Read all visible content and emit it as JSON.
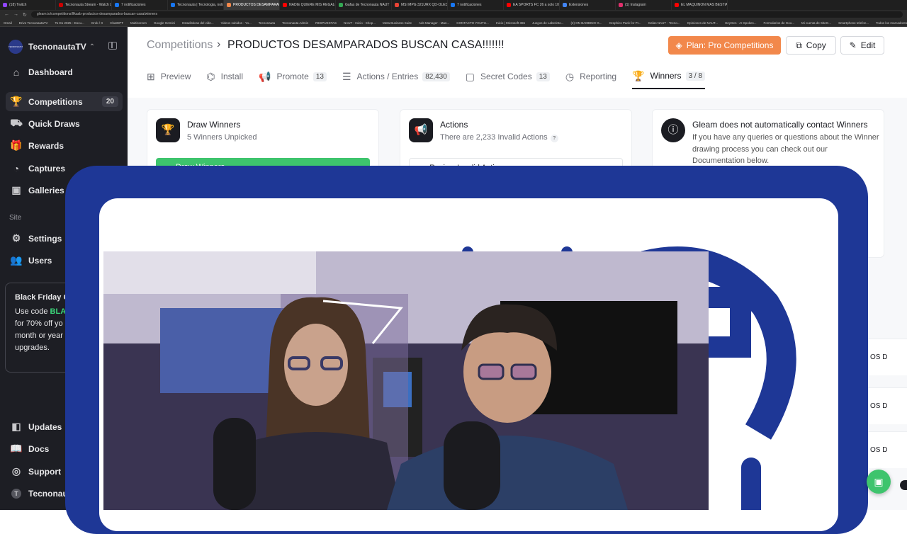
{
  "browser": {
    "tabs": [
      {
        "label": "(18) Twitch",
        "color": "#9146ff",
        "active": false
      },
      {
        "label": "Tecnonauta Stream - Watch Li",
        "color": "#cc0000",
        "active": false
      },
      {
        "label": "7 notificaciones",
        "color": "#1877f2",
        "active": false
      },
      {
        "label": "Tecnonauta | Tecnologia, noticia",
        "color": "#1877f2",
        "active": false
      },
      {
        "label": "PRODUCTOS DESAMPARADO",
        "color": "#f2884b",
        "active": true
      },
      {
        "label": "NADIE QUIERE MIS REGALOS!",
        "color": "#ff0000",
        "active": false
      },
      {
        "label": "Gafas de Tecnonauta NAUT",
        "color": "#34a853",
        "active": false
      },
      {
        "label": "MSI MPG 321URX QD-OLED M",
        "color": "#ea4335",
        "active": false
      },
      {
        "label": "7 notificaciones",
        "color": "#1877f2",
        "active": false
      },
      {
        "label": "EA SPORTS FC 26 a solo 10,50",
        "color": "#ff0000",
        "active": false
      },
      {
        "label": "Extensiones",
        "color": "#4285f4",
        "active": false
      },
      {
        "label": "(1) Instagram",
        "color": "#e1306c",
        "active": false
      },
      {
        "label": "EL MAQUINON MAS BESTIAL",
        "color": "#ff0000",
        "active": false
      }
    ],
    "url": "gleam.io/competitions/Ifkasb-productos-desamparados-buscan-casa/winners",
    "bookmarks": [
      "Gmail",
      "Drive TecnonautaTV",
      "To Do 2025 - Docu...",
      "Grok / X",
      "ChatGPT",
      "Multiscreen",
      "Google Gemini",
      "Estadisticas del vide...",
      "Videos subidos - Yo...",
      "Tecnonauta",
      "Tecnonauta Admin",
      "RESPUESTAS",
      "NAUT - Inicio - Shop...",
      "Meta Business Suite",
      "Ads Manager - Man...",
      "CONTACTO YOUTU...",
      "Inicio | Microsoft 365",
      "Juegos de Laberinto...",
      "(2) ON BAMBINO G...",
      "Graphics Pack for Pr...",
      "Gafas NAUT - Tecno...",
      "Opiniones de NAUT...",
      "HeyGen - AI Spokes...",
      "Formularios de Goo...",
      "Mi cuenta de SiteG...",
      "Smartphone telefon...",
      "Todos los marcadores"
    ]
  },
  "sidebar": {
    "brand": "TecnonautaTV",
    "brand_logo": "TECNONAUTA",
    "items": [
      {
        "label": "Dashboard",
        "icon": "home-icon",
        "glyph": "⌂"
      },
      {
        "label": "Competitions",
        "icon": "trophy-icon",
        "glyph": "🏆",
        "count": "20"
      },
      {
        "label": "Quick Draws",
        "icon": "quick-draw-icon",
        "glyph": "⛟"
      },
      {
        "label": "Rewards",
        "icon": "gift-icon",
        "glyph": "🎁"
      },
      {
        "label": "Captures",
        "icon": "capture-icon",
        "glyph": "◔"
      },
      {
        "label": "Galleries",
        "icon": "image-icon",
        "glyph": "▣"
      }
    ],
    "site_label": "Site",
    "site_items": [
      {
        "label": "Settings",
        "icon": "gear-icon",
        "glyph": "⚙"
      },
      {
        "label": "Users",
        "icon": "users-icon",
        "glyph": "👥"
      }
    ],
    "promo": {
      "title": "Black Friday C",
      "line1_pre": "Use code ",
      "line1_code": "BLA",
      "line2": "for 70% off yo",
      "line3": "month or year",
      "line4": "upgrades."
    },
    "bottom_items": [
      {
        "label": "Updates",
        "icon": "updates-icon",
        "glyph": "◧"
      },
      {
        "label": "Docs",
        "icon": "book-icon",
        "glyph": "📖"
      },
      {
        "label": "Support",
        "icon": "support-icon",
        "glyph": "◎"
      },
      {
        "label": "Tecnonaut",
        "icon": "avatar",
        "glyph": "T"
      }
    ]
  },
  "header": {
    "breadcrumb_link": "Competitions",
    "breadcrumb_sep": "›",
    "title": "PRODUCTOS DESAMPARADOS BUSCAN CASA!!!!!!!",
    "plan_button": "Plan: Pro Competitions",
    "copy_button": "Copy",
    "edit_button": "Edit"
  },
  "tabs": [
    {
      "label": "Preview",
      "icon": "grid-icon",
      "glyph": "⊞"
    },
    {
      "label": "Install",
      "icon": "install-icon",
      "glyph": "⌬"
    },
    {
      "label": "Promote",
      "icon": "megaphone-icon",
      "glyph": "📢",
      "count": "13"
    },
    {
      "label": "Actions / Entries",
      "icon": "list-icon",
      "glyph": "☰",
      "count": "82,430"
    },
    {
      "label": "Secret Codes",
      "icon": "code-icon",
      "glyph": "▢",
      "count": "13"
    },
    {
      "label": "Reporting",
      "icon": "chart-icon",
      "glyph": "◷"
    },
    {
      "label": "Winners",
      "icon": "trophy-icon",
      "glyph": "🏆",
      "count": "3 / 8",
      "active": true
    }
  ],
  "cards": {
    "draw": {
      "title": "Draw Winners",
      "subtitle": "5 Winners Unpicked",
      "button": "Draw Winners"
    },
    "actions": {
      "title": "Actions",
      "subtitle": "There are 2,233 Invalid Actions",
      "help": "?",
      "button": "Review Invalid Actions"
    },
    "info": {
      "title": "Gleam does not automatically contact Winners",
      "body": "If you have any queries or questions about the Winner drawing process you can check out our Documentation below."
    }
  },
  "side_fragments": [
    "OS D",
    "OS D",
    "OS D"
  ],
  "colors": {
    "accent_orange": "#f2884b",
    "accent_green": "#3ec46d",
    "overlay_blue": "#1e3796",
    "sidebar_bg": "#1d1e24"
  }
}
